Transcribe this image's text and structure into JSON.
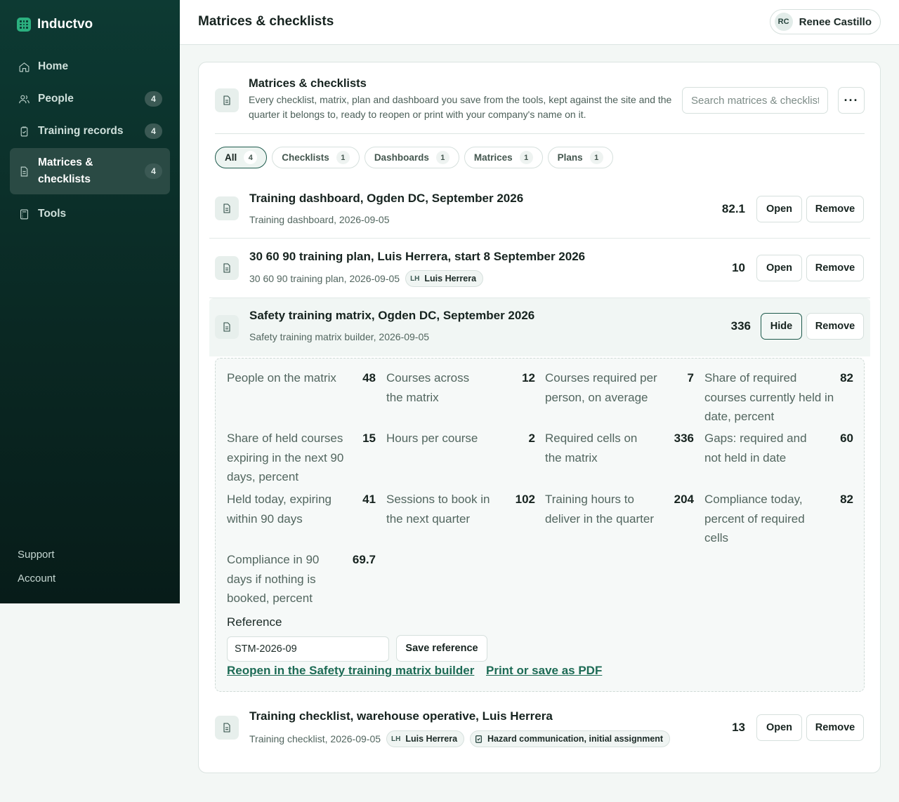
{
  "app": {
    "name": "Inductvo"
  },
  "sidebar": {
    "items": [
      {
        "label": "Home",
        "badge": ""
      },
      {
        "label": "People",
        "badge": "4"
      },
      {
        "label": "Training records",
        "badge": "4"
      },
      {
        "label": "Matrices & checklists",
        "badge": "4"
      },
      {
        "label": "Tools",
        "badge": ""
      }
    ],
    "footer": [
      "Support",
      "Account"
    ]
  },
  "header": {
    "title": "Matrices & checklists",
    "user": {
      "initials": "RC",
      "name": "Renee Castillo"
    }
  },
  "card": {
    "title": "Matrices & checklists",
    "description": "Every checklist, matrix, plan and dashboard you save from the tools, kept against the site and the quarter it belongs to, ready to reopen or print with your company's name on it.",
    "search_placeholder": "Search matrices & checklists",
    "more_label": "···"
  },
  "filters": [
    {
      "label": "All",
      "count": "4"
    },
    {
      "label": "Checklists",
      "count": "1"
    },
    {
      "label": "Dashboards",
      "count": "1"
    },
    {
      "label": "Matrices",
      "count": "1"
    },
    {
      "label": "Plans",
      "count": "1"
    }
  ],
  "rows": [
    {
      "title": "Training dashboard, Ogden DC, September 2026",
      "meta": "Training dashboard, 2026-09-05",
      "value": "82.1",
      "action": "Open",
      "remove": "Remove"
    },
    {
      "title": "30 60 90 training plan, Luis Herrera, start 8 September 2026",
      "meta": "30 60 90 training plan, 2026-09-05",
      "chip": {
        "initials": "LH",
        "name": "Luis Herrera"
      },
      "value": "10",
      "action": "Open",
      "remove": "Remove"
    },
    {
      "title": "Safety training matrix, Ogden DC, September 2026",
      "meta": "Safety training matrix builder, 2026-09-05",
      "value": "336",
      "action": "Hide",
      "remove": "Remove"
    },
    {
      "title": "Training checklist, warehouse operative, Luis Herrera",
      "meta": "Training checklist, 2026-09-05",
      "chip": {
        "initials": "LH",
        "name": "Luis Herrera"
      },
      "chip2": "Hazard communication, initial assignment",
      "value": "13",
      "action": "Open",
      "remove": "Remove"
    }
  ],
  "detail": {
    "stats": [
      {
        "label": "People on the matrix",
        "value": "48"
      },
      {
        "label": "Courses across the matrix",
        "value": "12"
      },
      {
        "label": "Courses required per person, on average",
        "value": "7"
      },
      {
        "label": "Share of required courses currently held in date, percent",
        "value": "82"
      },
      {
        "label": "Share of held courses expiring in the next 90 days, percent",
        "value": "15"
      },
      {
        "label": "Hours per course",
        "value": "2"
      },
      {
        "label": "Required cells on the matrix",
        "value": "336"
      },
      {
        "label": "Gaps: required and not held in date",
        "value": "60"
      },
      {
        "label": "Held today, expiring within 90 days",
        "value": "41"
      },
      {
        "label": "Sessions to book in the next quarter",
        "value": "102"
      },
      {
        "label": "Training hours to deliver in the quarter",
        "value": "204"
      },
      {
        "label": "Compliance today, percent of required cells",
        "value": "82"
      },
      {
        "label": "Compliance in 90 days if nothing is booked, percent",
        "value": "69.7"
      }
    ],
    "reference_label": "Reference",
    "reference_value": "STM-2026-09",
    "save_label": "Save reference",
    "reopen_link": "Reopen in the Safety training matrix builder",
    "print_link": "Print or save as PDF"
  }
}
